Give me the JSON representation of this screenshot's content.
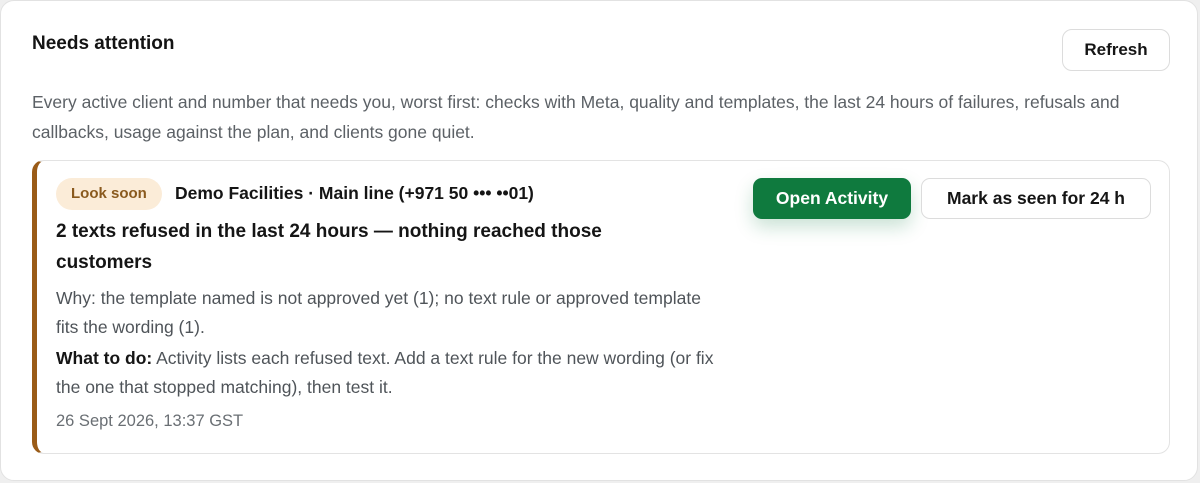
{
  "panel": {
    "title": "Needs attention",
    "refresh_label": "Refresh",
    "intro": "Every active client and number that needs you, worst first: checks with Meta, quality and templates, the last 24 hours of failures, refusals and callbacks, usage against the plan, and clients gone quiet."
  },
  "items": [
    {
      "badge": "Look soon",
      "subject": "Demo Facilities · Main line (+971 50 ••• ••01)",
      "headline": "2 texts refused in the last 24 hours — nothing reached those customers",
      "why": "Why: the template named is not approved yet (1); no text rule or approved template fits the wording (1).",
      "todo_label": "What to do:",
      "todo_text": " Activity lists each refused text. Add a text rule for the new wording (or fix the one that stopped matching), then test it.",
      "timestamp": "26 Sept 2026, 13:37 GST",
      "open_label": "Open Activity",
      "dismiss_label": "Mark as seen for 24 h"
    }
  ],
  "colors": {
    "accent_green": "#0f7a3e",
    "warning_border": "#9a5b17",
    "badge_bg": "#fbecd8",
    "badge_text": "#8a5a1e"
  }
}
